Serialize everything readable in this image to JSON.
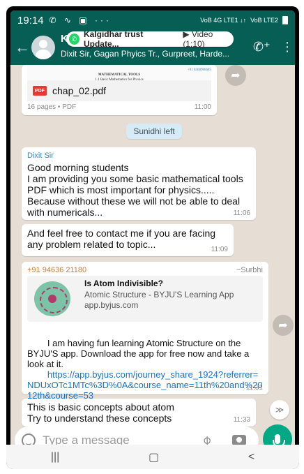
{
  "status": {
    "time": "19:14",
    "icons": "✆ ∿ ▣ ···",
    "net1": "VoB 4G LTE1 ↓↑",
    "net2": "VoB LTE2"
  },
  "header": {
    "title": "Kalgidhar trust Update...",
    "subtitle": "Dixit Sir, Gagan Phyics Tr., Gurpreet, Harde...",
    "video_label": "Video (1:10)"
  },
  "pdf": {
    "preview_title": "MATHEMATICAL TOOLS",
    "preview_subtitle": "1.1 Basic Mathematics for Physics",
    "preview_phone": "+91 8468986685",
    "badge": "PDF",
    "filename": "chap_02.pdf",
    "meta": "16 pages • PDF",
    "time": "11:00"
  },
  "system_message": "Sunidhi left",
  "messages": [
    {
      "sender": "Dixit Sir",
      "text": "Good morning students\nI am providing you some basic mathematical tools PDF which is most important for physics.....\nBecause without these we will not be able to deal with numericals...",
      "time": "11:06"
    },
    {
      "text": "And feel free to contact me if you are facing any problem related to topic...",
      "time": "11:09"
    },
    {
      "sender_phone": "+91 94636 21180",
      "sender_alias": "~Surbhi",
      "link_title": "Is Atom Indivisible?",
      "link_desc": "Atomic Structure - BYJU'S Learning App",
      "link_domain": "app.byjus.com",
      "text": "I am having fun learning Atomic Structure on the BYJU'S app. Download the app for free now and take a look at it.",
      "url": "https://app.byjus.com/journey_share_1924?referrer=NDUxOTc1MTc%3D%0A&course_name=11th%20and%2012th&course=53",
      "time": "11:31"
    },
    {
      "text": "This is basic concepts about atom\nTry to understand these concepts",
      "time": "11:33"
    }
  ],
  "composer": {
    "placeholder": "Type a message"
  },
  "nav": {
    "recents": "|||",
    "home": "▢",
    "back": "<"
  }
}
